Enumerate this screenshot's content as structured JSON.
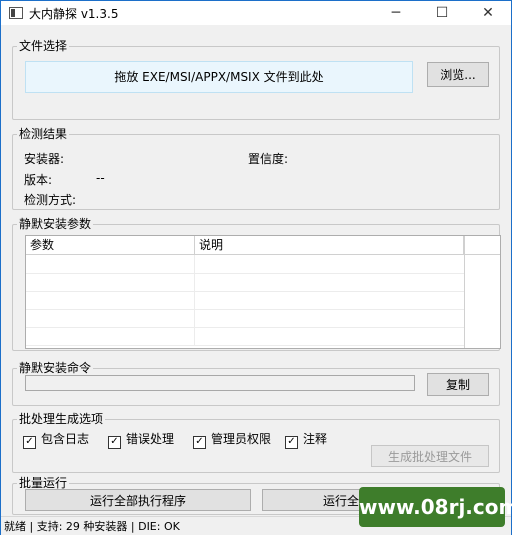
{
  "window": {
    "title": "大内静探 v1.3.5",
    "minimize": "─",
    "maximize": "☐",
    "close": "✕"
  },
  "file_select": {
    "legend": "文件选择",
    "drop_text": "拖放 EXE/MSI/APPX/MSIX 文件到此处",
    "browse_label": "浏览..."
  },
  "detect": {
    "legend": "检测结果",
    "installer_label": "安装器:",
    "confidence_label": "置信度:",
    "version_label": "版本:",
    "version_value": "--",
    "method_label": "检测方式:"
  },
  "params": {
    "legend": "静默安装参数",
    "columns": [
      "参数",
      "说明"
    ]
  },
  "command": {
    "legend": "静默安装命令",
    "value": "",
    "copy_label": "复制"
  },
  "batch_options": {
    "legend": "批处理生成选项",
    "options": [
      {
        "label": "包含日志",
        "checked": true
      },
      {
        "label": "错误处理",
        "checked": true
      },
      {
        "label": "管理员权限",
        "checked": true
      },
      {
        "label": "注释",
        "checked": true
      }
    ],
    "generate_label": "生成批处理文件"
  },
  "batch_run": {
    "legend": "批量运行",
    "run_all_label": "运行全部执行程序",
    "run_all2_label": "运行全"
  },
  "status": {
    "text": "就绪 | 支持: 29 种安装器 | DIE: OK"
  },
  "watermark": {
    "text": "www.08rj.com",
    "color": "#3e7d2b"
  },
  "colors": {
    "accent_border": "#1c6fc9",
    "drop_bg": "#eaf6fd"
  }
}
